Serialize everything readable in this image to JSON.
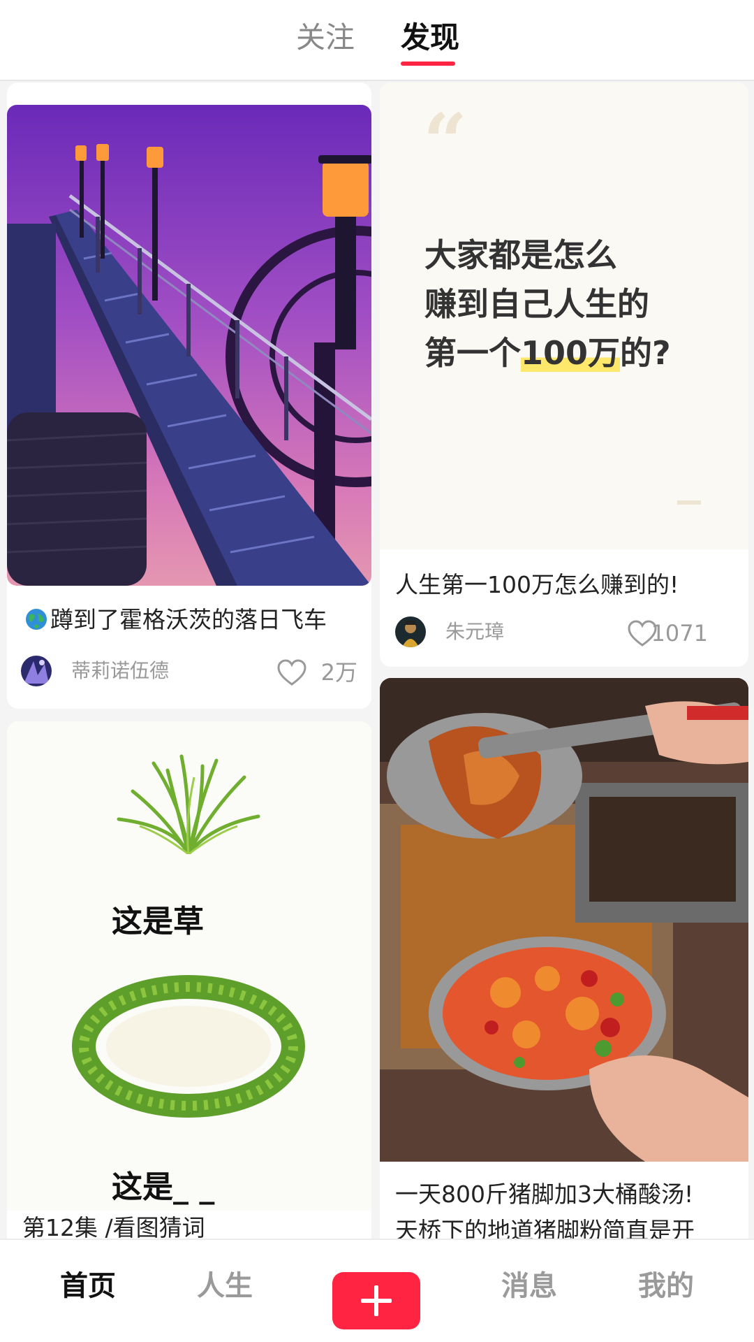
{
  "top_tabs": [
    {
      "label": "关注",
      "active": false
    },
    {
      "label": "发现",
      "active": true
    }
  ],
  "accent_color": "#ff2442",
  "feed": {
    "card1": {
      "title": "蹲到了霍格沃茨的落日飞车",
      "title_icon": "globe-icon",
      "author": "蒂莉诺伍德",
      "likes": "2万"
    },
    "card2": {
      "quote_lines": [
        "大家都是怎么",
        "赚到自己人生的",
        "第一个"
      ],
      "quote_highlight": "100万",
      "quote_tail": "的?",
      "title": "人生第一100万怎么赚到的!",
      "author": "朱元璋",
      "likes": "1071"
    },
    "card3": {
      "label_top": "这是草",
      "label_bottom": "这是_ _",
      "title": "第12集 /看图猜词"
    },
    "card4": {
      "title_line1": "一天800斤猪脚加3大桶酸汤!",
      "title_line2": "天桥下的地道猪脚粉简直是开"
    }
  },
  "bottom_nav": {
    "home": "首页",
    "life": "人生",
    "add_icon": "plus-icon",
    "messages": "消息",
    "me": "我的"
  }
}
